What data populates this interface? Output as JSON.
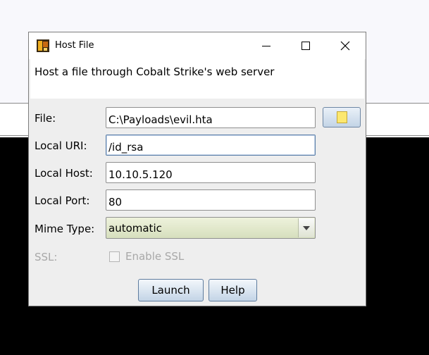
{
  "dialog": {
    "title": "Host File",
    "description": "Host a file through Cobalt Strike's web server",
    "fields": {
      "file": {
        "label": "File:",
        "value": "C:\\Payloads\\evil.hta"
      },
      "local_uri": {
        "label": "Local URI:",
        "value": "/id_rsa"
      },
      "local_host": {
        "label": "Local Host:",
        "value": "10.10.5.120"
      },
      "local_port": {
        "label": "Local Port:",
        "value": "80"
      },
      "mime_type": {
        "label": "Mime Type:",
        "value": "automatic"
      },
      "ssl": {
        "label": "SSL:",
        "checkbox_label": "Enable SSL",
        "checked": false,
        "enabled": false
      }
    },
    "buttons": {
      "launch": "Launch",
      "help": "Help"
    }
  },
  "icons": [
    "app-icon",
    "minimize-icon",
    "maximize-icon",
    "close-icon",
    "folder-icon",
    "dropdown-arrow-icon"
  ],
  "colors": {
    "console_bg": "#000000",
    "button_gradient_bottom": "#c3d4e6",
    "select_bg": "#d6dfbd"
  }
}
